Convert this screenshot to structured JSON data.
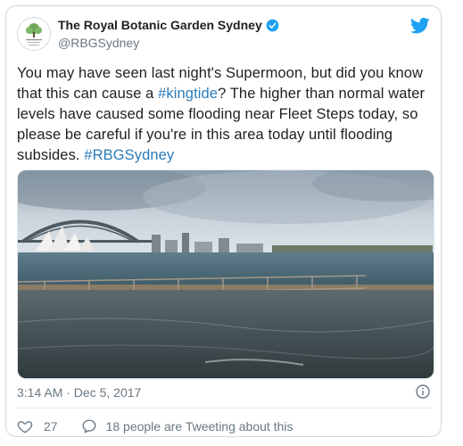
{
  "author": {
    "name": "The Royal Botanic Garden Sydney",
    "handle": "@RBGSydney"
  },
  "tweet": {
    "text_1": "You may have seen last night's Supermoon, but did you know that this can cause a ",
    "hashtag_1": "#kingtide",
    "text_2": "? The higher than normal water levels have caused some flooding near Fleet Steps today, so please be careful if you're in this area today until flooding subsides. ",
    "hashtag_2": "#RBGSydney"
  },
  "meta": {
    "timestamp": "3:14 AM · Dec 5, 2017"
  },
  "actions": {
    "like_count": "27",
    "conversation_label": "18 people are Tweeting about this"
  },
  "colors": {
    "link": "#2b7bb9",
    "twitter_blue": "#1da1f2",
    "muted": "#697882"
  },
  "icons": [
    "rbg-logo-icon",
    "verified-badge-icon",
    "twitter-bird-icon",
    "info-icon",
    "heart-icon",
    "reply-bubble-icon"
  ]
}
